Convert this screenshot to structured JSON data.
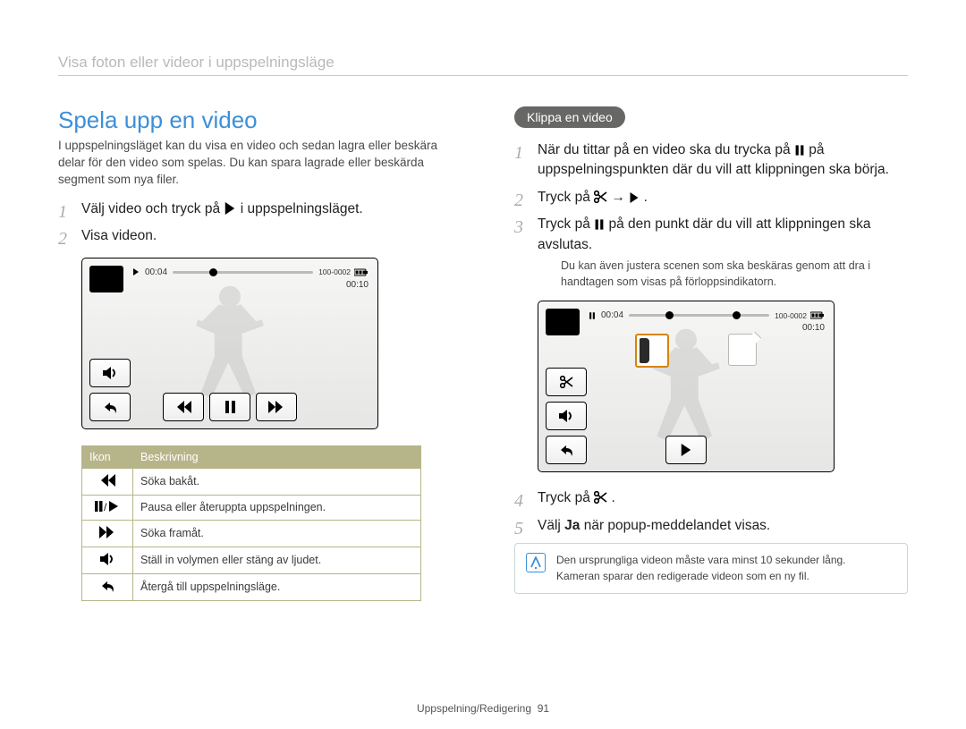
{
  "breadcrumb": "Visa foton eller videor i uppspelningsläge",
  "left": {
    "title": "Spela upp en video",
    "intro": "I uppspelningsläget kan du visa en video och sedan lagra eller beskära delar för den video som spelas. Du kan spara lagrade eller beskärda segment som nya filer.",
    "step1_pre": "Välj video och tryck på ",
    "step1_post": " i uppspelningsläget.",
    "step2": "Visa videon.",
    "player": {
      "time_left": "00:04",
      "time_right": "00:10",
      "fileno": "100-0002"
    },
    "table": {
      "h_icon": "Ikon",
      "h_desc": "Beskrivning",
      "rows": [
        {
          "icon": "rewind",
          "desc": "Söka bakåt."
        },
        {
          "icon": "pauseplay",
          "desc": "Pausa eller återuppta uppspelningen."
        },
        {
          "icon": "forward",
          "desc": "Söka framåt."
        },
        {
          "icon": "volume",
          "desc": "Ställ in volymen eller stäng av ljudet."
        },
        {
          "icon": "back",
          "desc": "Återgå till uppspelningsläge."
        }
      ]
    }
  },
  "right": {
    "badge": "Klippa en video",
    "step1_a": "När du tittar på en video ska du trycka på ",
    "step1_b": " på uppspelningspunkten där du vill att klippningen ska börja.",
    "step2_a": "Tryck på ",
    "step2_arrow": " → ",
    "step2_b": ".",
    "step3_a": "Tryck på ",
    "step3_b": " på den punkt där du vill att klippningen ska avslutas.",
    "step3_note": "Du kan även justera scenen som ska beskäras genom att dra i handtagen som visas på förloppsindikatorn.",
    "player": {
      "time_left": "00:04",
      "time_right": "00:10",
      "fileno": "100-0002"
    },
    "step4_a": "Tryck på ",
    "step4_b": ".",
    "step5_a": "Välj ",
    "step5_bold": "Ja",
    "step5_b": " när popup-meddelandet visas.",
    "tip1": "Den ursprungliga videon måste vara minst 10 sekunder lång.",
    "tip2": "Kameran sparar den redigerade videon som en ny fil."
  },
  "footer": {
    "section": "Uppspelning/Redigering",
    "page": "91"
  }
}
